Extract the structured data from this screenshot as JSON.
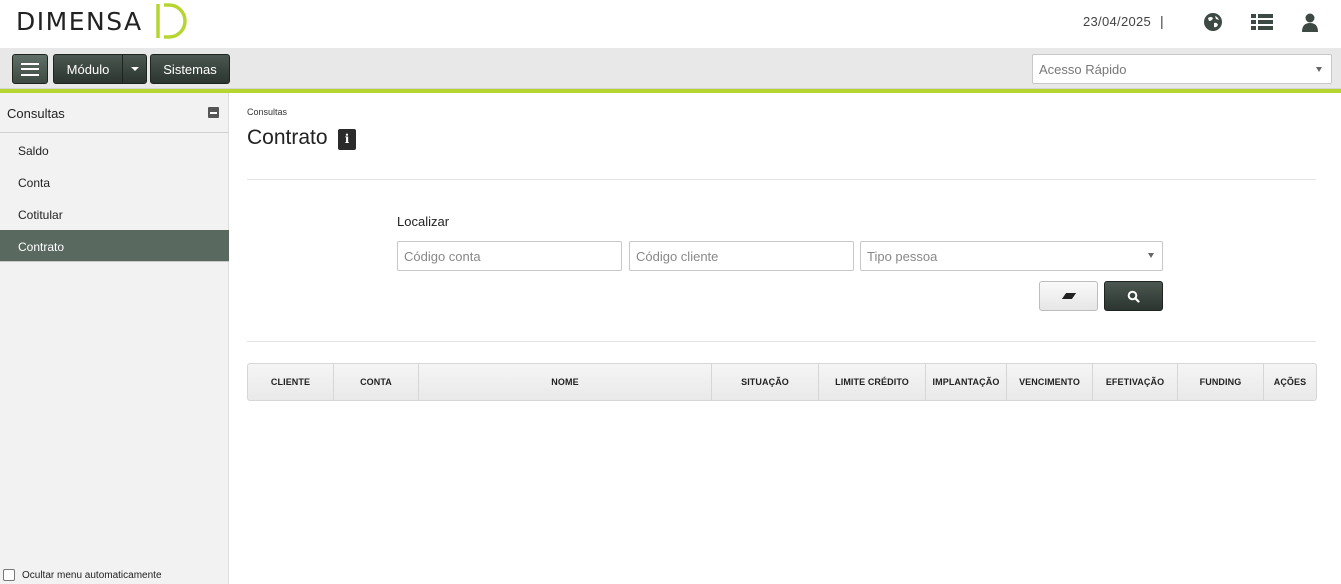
{
  "header": {
    "logo_text": "Dimensa",
    "date": "23/04/2025",
    "separator": "|",
    "icons": [
      "globe-icon",
      "list-icon",
      "user-icon"
    ]
  },
  "toolbar": {
    "menu_icon": "hamburger-icon",
    "modulo_label": "Módulo",
    "sistemas_label": "Sistemas",
    "quick_access_placeholder": "Acesso Rápido"
  },
  "sidebar": {
    "title": "Consultas",
    "items": [
      {
        "label": "Saldo",
        "active": false
      },
      {
        "label": "Conta",
        "active": false
      },
      {
        "label": "Cotitular",
        "active": false
      },
      {
        "label": "Contrato",
        "active": true
      }
    ],
    "hide_menu_label": "Ocultar menu automaticamente"
  },
  "main": {
    "breadcrumb": "Consultas",
    "title": "Contrato",
    "info_icon": "i",
    "search": {
      "label": "Localizar",
      "codigo_conta_placeholder": "Código conta",
      "codigo_cliente_placeholder": "Código cliente",
      "tipo_pessoa_placeholder": "Tipo pessoa"
    },
    "table": {
      "columns": [
        "CLIENTE",
        "CONTA",
        "NOME",
        "SITUAÇÃO",
        "LIMITE CRÉDITO",
        "IMPLANTAÇÃO",
        "VENCIMENTO",
        "EFETIVAÇÃO",
        "FUNDING",
        "AÇÕES"
      ],
      "rows": []
    }
  },
  "colors": {
    "accent_green": "#b7d531",
    "dark_button": "#3a4640",
    "active_sidebar": "#59695f"
  }
}
